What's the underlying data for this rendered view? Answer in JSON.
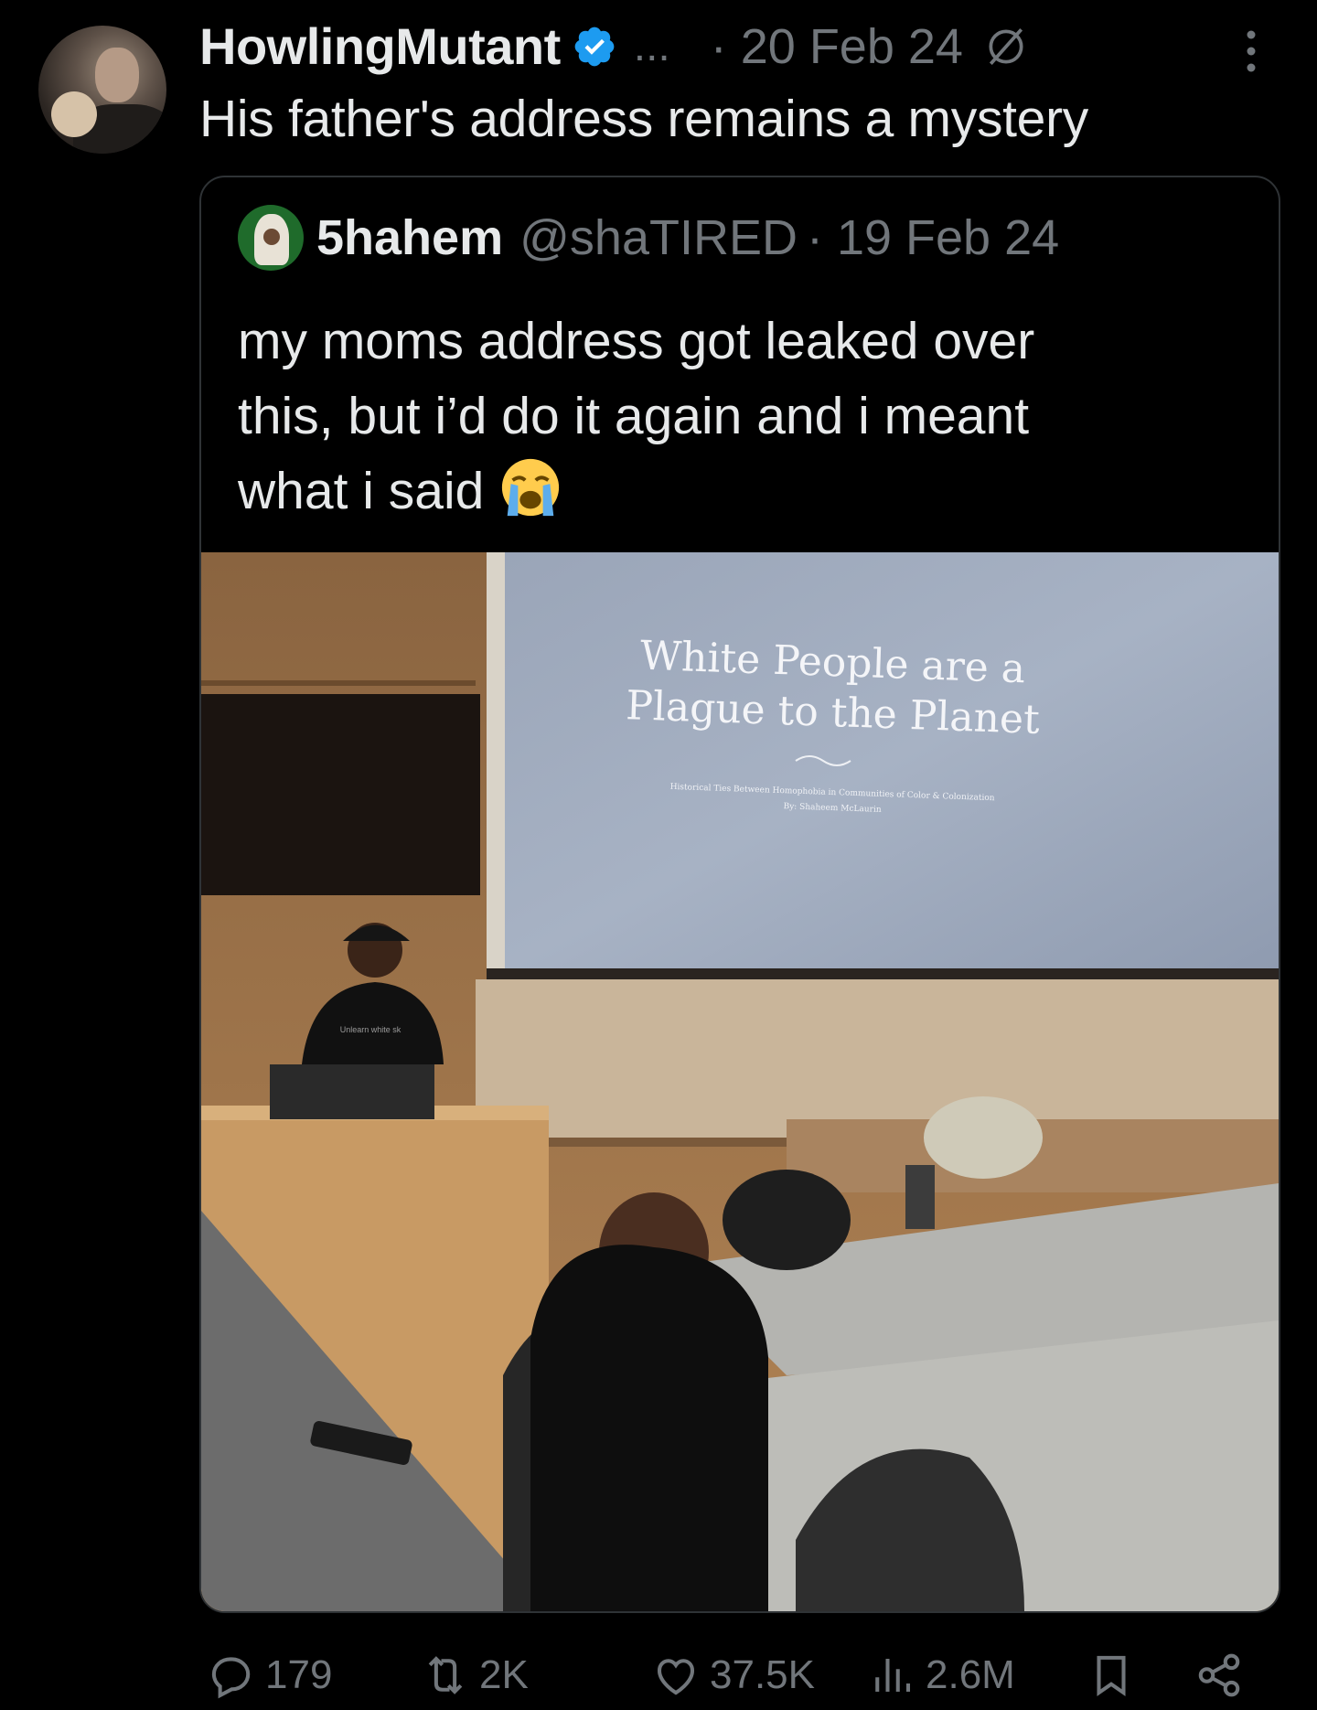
{
  "tweet": {
    "display_name": "HowlingMutant",
    "ellipsis": "...",
    "date": "· 20 Feb 24",
    "text": "His father's address remains a mystery"
  },
  "quoted": {
    "display_name": "5hahem",
    "handle": "@shaTIRED",
    "date": "· 19 Feb 24",
    "text_line1": "my moms address got leaked over",
    "text_line2": "this, but i’d do it again and i meant",
    "text_line3": "what i said",
    "photo": {
      "slide_title_line1": "White People are a",
      "slide_title_line2": "Plague to the Planet",
      "slide_subtitle": "Historical Ties Between Homophobia in Communities of Color & Colonization",
      "slide_byline": "By: Shaheem McLaurin",
      "shirt_text": "Unlearn white sk"
    }
  },
  "actions": {
    "replies": "179",
    "reposts": "2K",
    "likes": "37.5K",
    "views": "2.6M"
  },
  "colors": {
    "background": "#000000",
    "text_primary": "#e7e9ea",
    "text_secondary": "#71767b",
    "verified": "#1d9bf0",
    "border": "#2f3336"
  },
  "icons": [
    "verified-badge-icon",
    "grok-icon",
    "more-icon",
    "reply-icon",
    "repost-icon",
    "like-icon",
    "views-icon",
    "bookmark-icon",
    "share-icon",
    "loudly-crying-face-emoji"
  ]
}
